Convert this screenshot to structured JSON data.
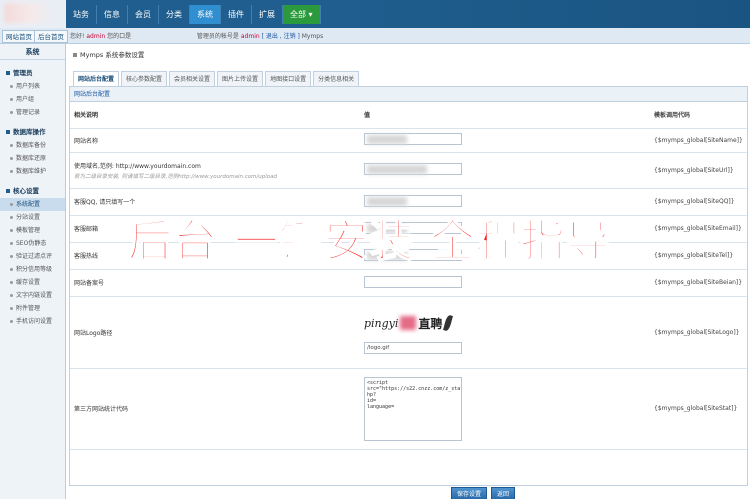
{
  "top_nav": [
    {
      "label": "站务",
      "state": "normal"
    },
    {
      "label": "信息",
      "state": "normal"
    },
    {
      "label": "会员",
      "state": "normal"
    },
    {
      "label": "分类",
      "state": "normal"
    },
    {
      "label": "系统",
      "state": "active"
    },
    {
      "label": "插件",
      "state": "normal"
    },
    {
      "label": "扩展",
      "state": "normal"
    },
    {
      "label": "全部 ▾",
      "state": "green"
    }
  ],
  "quick_tabs": [
    "网站首页",
    "后台首页"
  ],
  "breadcrumb": {
    "prefix": "您好!",
    "user": "admin",
    "middle": "您的口是",
    "suffix": "管理员的帐号是",
    "user2": "admin",
    "links": "[ 退出 , 注销 ]",
    "site": "Mymps"
  },
  "sidebar": {
    "title": "系统",
    "groups": [
      {
        "label": "管理员",
        "items": [
          {
            "label": "用户列表",
            "active": false
          },
          {
            "label": "用户组",
            "active": false
          },
          {
            "label": "管理记录",
            "active": false
          }
        ]
      },
      {
        "label": "数据库操作",
        "items": [
          {
            "label": "数据库备份",
            "active": false
          },
          {
            "label": "数据库还原",
            "active": false
          },
          {
            "label": "数据库维护",
            "active": false
          }
        ]
      },
      {
        "label": "核心设置",
        "items": [
          {
            "label": "系统配置",
            "active": true
          },
          {
            "label": "分站设置",
            "active": false
          },
          {
            "label": "模板管理",
            "active": false
          },
          {
            "label": "SEO伪静态",
            "active": false
          },
          {
            "label": "验证过滤点评",
            "active": false
          },
          {
            "label": "积分信用等级",
            "active": false
          },
          {
            "label": "缓存设置",
            "active": false
          },
          {
            "label": "文字内链设置",
            "active": false
          },
          {
            "label": "附件管理",
            "active": false
          },
          {
            "label": "手机访问设置",
            "active": false
          }
        ]
      }
    ]
  },
  "page_title": "Mymps 系统参数设置",
  "tabs": [
    {
      "label": "网站后台配置",
      "active": true
    },
    {
      "label": "核心参数配置",
      "active": false
    },
    {
      "label": "会员相关设置",
      "active": false
    },
    {
      "label": "图片上传设置",
      "active": false
    },
    {
      "label": "地图接口设置",
      "active": false
    },
    {
      "label": "分类信息相关",
      "active": false
    }
  ],
  "panel_heading": "网站后台配置",
  "table": {
    "headers": [
      "相关说明",
      "值",
      "模板调用代码"
    ],
    "rows": [
      {
        "label": "网站名称",
        "hint": "",
        "value": "",
        "code": "{$mymps_global[SiteName]}"
      },
      {
        "label": "使用域名,范例: http://www.yourdomain.com",
        "hint": "若为二级目录安装, 则请填写二级目录,范例http://www.yourdomain.com/upload",
        "value": "",
        "code": "{$mymps_global[SiteUrl]}"
      },
      {
        "label": "客服QQ, 请只填写一个",
        "hint": "",
        "value": "",
        "code": "{$mymps_global[SiteQQ]}"
      },
      {
        "label": "客服邮箱",
        "hint": "",
        "value": "",
        "code": "{$mymps_global[SiteEmail]}"
      },
      {
        "label": "客服热线",
        "hint": "",
        "value": "",
        "code": "{$mymps_global[SiteTel]}"
      },
      {
        "label": "网站备案号",
        "hint": "",
        "value": "",
        "code": "{$mymps_global[SiteBeian]}"
      },
      {
        "label": "网站Logo路径",
        "hint": "",
        "value": "/logo.gif",
        "code": "{$mymps_global[SiteLogo]}"
      },
      {
        "label": "第三方网站统计代码",
        "hint": "",
        "value": "<script\nsrc=\"https://s22.cnzz.com/z_stat.p\nhp?\nid=\nlanguage=",
        "code": "{$mymps_global[SiteStat]}"
      }
    ]
  },
  "logo_preview": {
    "text_a": "pingyi",
    "text_b": "直聘"
  },
  "buttons": {
    "save": "保存设置",
    "back": "返回"
  },
  "overlay_text": "后台  一键安装 全程指导",
  "colors": {
    "accent": "#1f5e8e",
    "overlay": "#f21f1f"
  }
}
